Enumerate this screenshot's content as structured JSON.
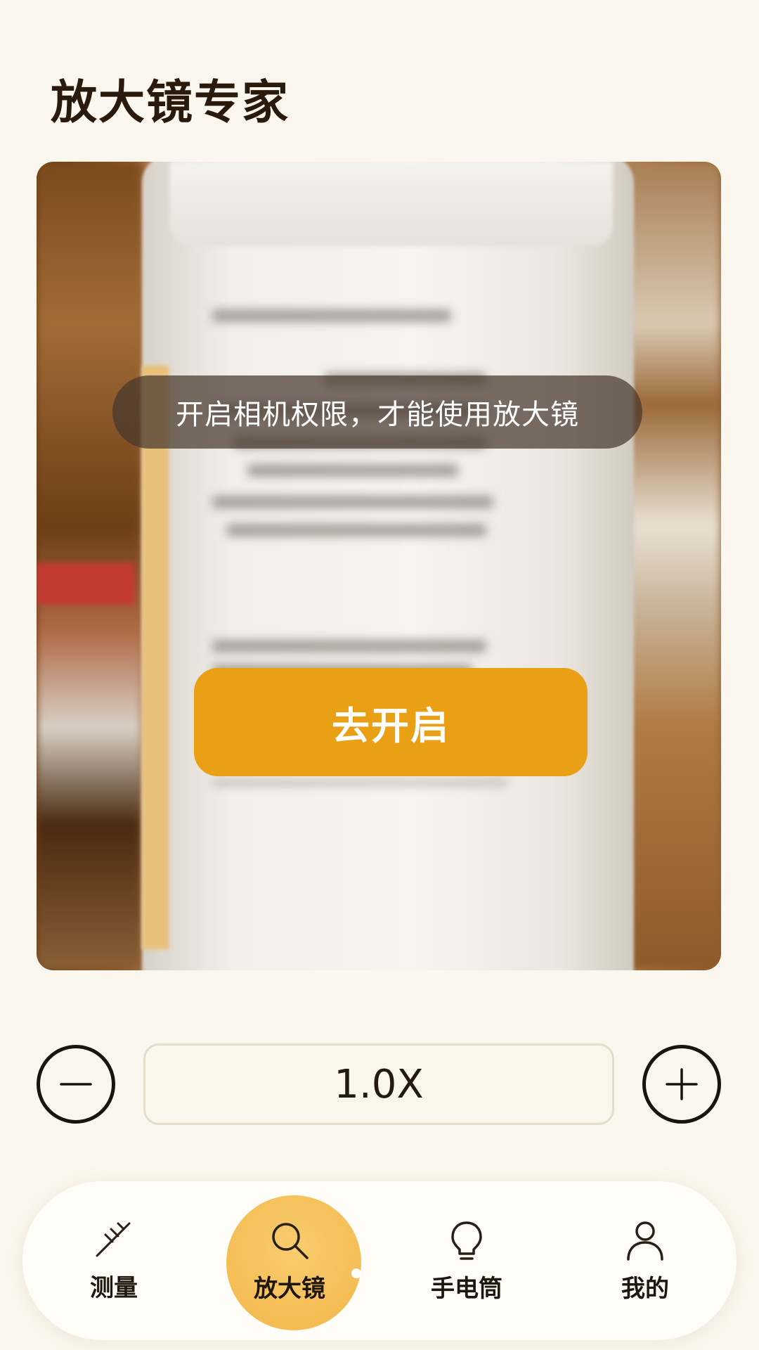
{
  "app": {
    "title": "放大镜专家"
  },
  "preview": {
    "permission_message": "开启相机权限，才能使用放大镜",
    "open_button_label": "去开启"
  },
  "zoom": {
    "value": "1.0X",
    "minus_icon": "minus-icon",
    "plus_icon": "plus-icon"
  },
  "nav": {
    "items": [
      {
        "label": "测量",
        "icon": "ruler-icon",
        "active": false
      },
      {
        "label": "放大镜",
        "icon": "magnifier-icon",
        "active": true
      },
      {
        "label": "手电筒",
        "icon": "lightbulb-icon",
        "active": false
      },
      {
        "label": "我的",
        "icon": "user-icon",
        "active": false
      }
    ]
  },
  "colors": {
    "background": "#fbf7ee",
    "accent": "#eaa015",
    "active_tab": "#f3b74a",
    "text_dark": "#1f160d"
  }
}
